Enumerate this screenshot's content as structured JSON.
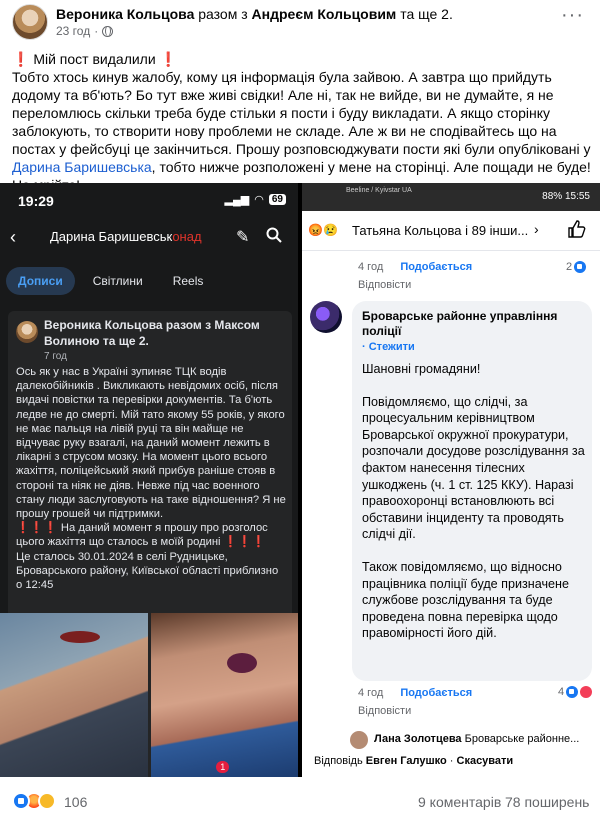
{
  "post": {
    "author": "Вероника Кольцова",
    "with_text": "разом з",
    "tagged": "Андреєм Кольцовим",
    "and_text": "та ще 2.",
    "time": "23 год",
    "text": {
      "line1_prefix": "❗",
      "line1": "Мій пост видалили",
      "line1_suffix": "❗",
      "body": "Тобто хтось кинув жалобу, кому ця інформація була зайвою. А завтра що прийдуть додому та вб'ють? Бо тут вже живі свідки! Але ні, так не вийде, ви не думайте, я не переломлюсь скільки треба буде стільки я пости і буду викладати. А якщо сторінку заблокують, то створити нову проблеми не складе. Але ж ви не сподівайтесь що на постах у фейсбуці це закінчиться. Прошу розповсюджувати пости які були опубліковані у",
      "mention": "Дарина Баришевська",
      "body_end": ", тобто нижче розположені у мене на сторінці. Але пощади не буде! Не мрійте!"
    }
  },
  "left_screenshot": {
    "time": "19:29",
    "battery": "69",
    "title": "Дарина Баришевськ",
    "title_badge": "онад",
    "tabs": [
      "Дописи",
      "Світлини",
      "Reels"
    ],
    "card": {
      "author": "Вероника Кольцова разом з Максом Волиною та ще 2.",
      "time": "7 год",
      "paragraph1": "Ось як у нас в Україні зупиняє ТЦК водів далекобійників . Викликають невідомих осіб, після видачі повістки та перевірки документів. Та б'ють ледве не до смерті. Мій тато якому 55 років, у якого не має пальця на лівій руці та він майще не відчуває руку взагалі, на даний момент лежить в лікарні з струсом мозку. На момент цього всього жахіття, поліцейський який прибув раніше стояв в стороні та ніяк не діяв. Невже під час военного стану люди заслуговують на таке відношення? Я не прошу грошей чи підтримки.",
      "excl_marks": "❗❗❗",
      "paragraph2": "На даний момент я прошу про розголос цього жахіття що сталось в моїй родині",
      "paragraph3": "Це сталось 30.01.2024 в селі Рудницьке, Броварського району, Київської області приблизно о 12:45"
    },
    "notif_count": "1"
  },
  "right_screenshot": {
    "status_left": "Beeline / Kyivstar UA",
    "status_right": "88% 15:55",
    "react_emojis": "😡😢",
    "react_text": "Татьяна Кольцова і 89 інши...",
    "comment1": {
      "time": "4 год",
      "like": "Подобається",
      "reply": "Відповісти",
      "count": "2"
    },
    "comment2": {
      "author": "Броварське районне управління поліції",
      "follow": "Стежити",
      "greeting": "Шановні громадяни!",
      "p1": "Повідомляємо, що слідчі, за процесуальним керівництвом Броварської окружної прокуратури, розпочали досудове розслідування за фактом нанесення тілесних ушкоджень (ч. 1 ст. 125 ККУ). Наразі правоохоронці встановлюють всі обставини інциденту та проводять слідчі дії.",
      "p2": "Також повідомляємо, що відносно працівника поліції буде призначене службове розслідування та буде проведена повна перевірка щодо правомірності його дій.",
      "time": "4 год",
      "like": "Подобається",
      "reply": "Відповісти",
      "count": "4"
    },
    "reply_author": "Лана Золотцева",
    "reply_target": "Броварське районне...",
    "replying_to_label": "Відповідь",
    "replying_to_name": "Евген Галушко",
    "cancel": "Скасувати"
  },
  "footer": {
    "reactions_count": "106",
    "comments": "9 коментарів",
    "shares": "78 поширень"
  },
  "colors": {
    "accent": "#1877f2",
    "mention": "#1d5fd1",
    "dark_bg": "#18191a"
  }
}
